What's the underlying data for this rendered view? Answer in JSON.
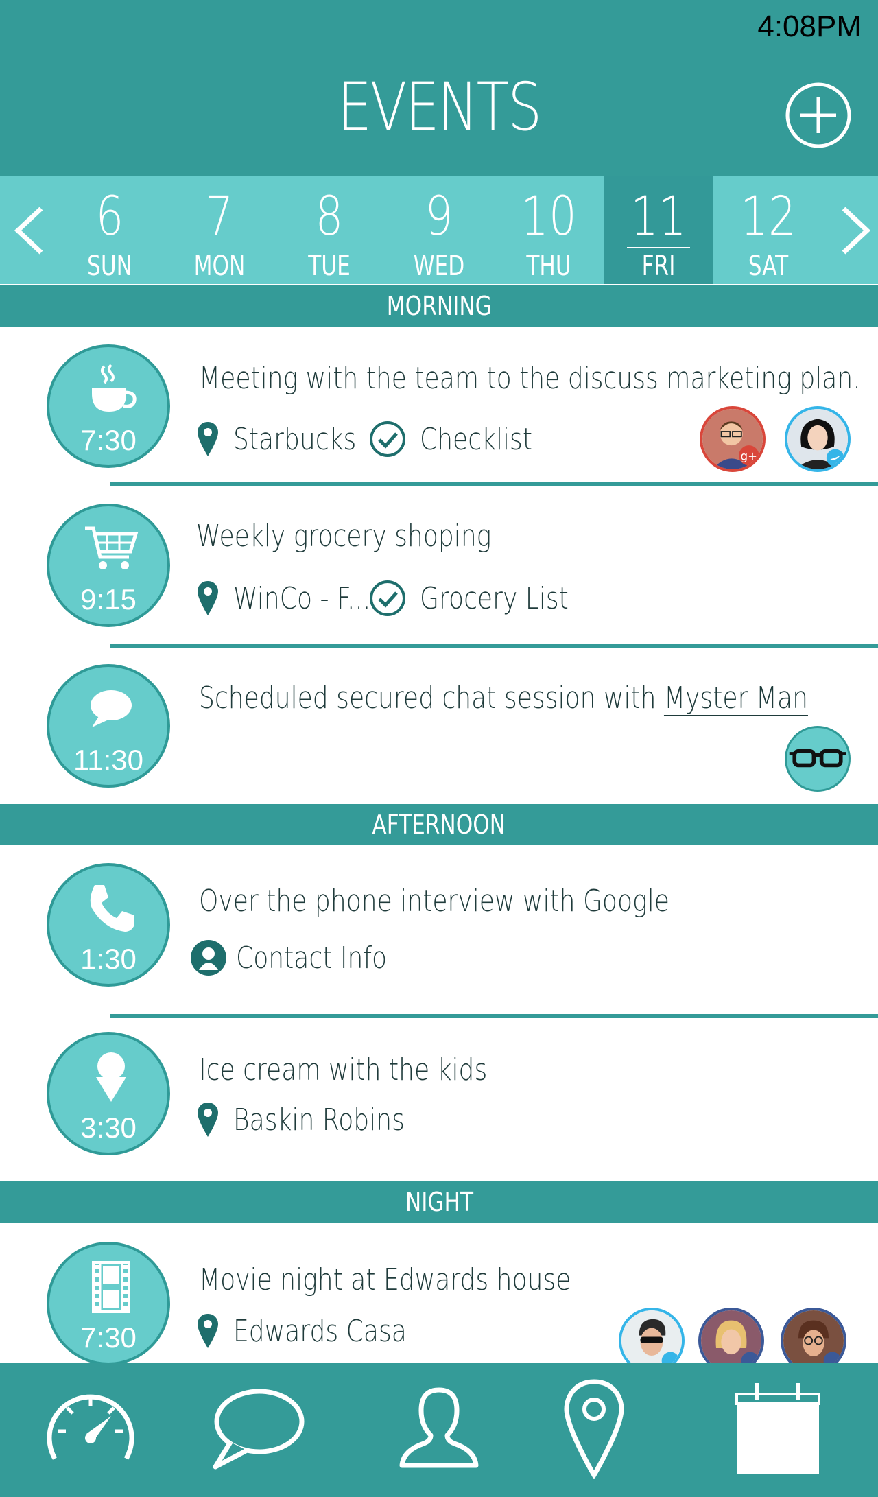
{
  "status_bar": {
    "time": "4:08PM"
  },
  "header": {
    "title": "EVENTS",
    "add_icon": "plus-circle-icon"
  },
  "date_strip": {
    "prev_icon": "chevron-left-icon",
    "next_icon": "chevron-right-icon",
    "days": [
      {
        "num": "6",
        "name": "SUN"
      },
      {
        "num": "7",
        "name": "MON"
      },
      {
        "num": "8",
        "name": "TUE"
      },
      {
        "num": "9",
        "name": "WED"
      },
      {
        "num": "10",
        "name": "THU"
      },
      {
        "num": "11",
        "name": "FRI",
        "selected": true
      },
      {
        "num": "12",
        "name": "SAT"
      }
    ]
  },
  "sections": {
    "morning": "MORNING",
    "afternoon": "AFTERNOON",
    "night": "NIGHT"
  },
  "events": [
    {
      "time": "7:30",
      "icon": "coffee-cup-icon",
      "title": "Meeting with the team to the discuss marketing plan.",
      "location": "Starbucks",
      "checklist": "Checklist",
      "attendees": [
        "google-plus-attendee",
        "twitter-attendee"
      ]
    },
    {
      "time": "9:15",
      "icon": "shopping-cart-icon",
      "title": "Weekly grocery shoping",
      "location": "WinCo - F...",
      "checklist": "Grocery List"
    },
    {
      "time": "11:30",
      "icon": "chat-bubble-icon",
      "title_prefix": "Scheduled secured chat session with ",
      "title_link": "Myster Man",
      "attendees": [
        "glasses-attendee"
      ]
    },
    {
      "time": "1:30",
      "icon": "phone-icon",
      "title": "Over the phone interview with Google",
      "contact": "Contact Info"
    },
    {
      "time": "3:30",
      "icon": "ice-cream-icon",
      "title": "Ice cream with the kids",
      "location": "Baskin Robins"
    },
    {
      "time": "7:30",
      "icon": "film-strip-icon",
      "title": "Movie night at Edwards house",
      "location": "Edwards Casa",
      "attendees": [
        "twitter-attendee",
        "facebook-attendee",
        "facebook-attendee"
      ]
    }
  ],
  "tabbar": {
    "items": [
      "speedometer-icon",
      "chat-icon",
      "person-icon",
      "map-pin-icon",
      "calendar-icon"
    ],
    "active": "calendar-icon"
  },
  "colors": {
    "primary": "#349b98",
    "light": "#66cccb",
    "text": "#1f3b3b",
    "white": "#ffffff"
  }
}
